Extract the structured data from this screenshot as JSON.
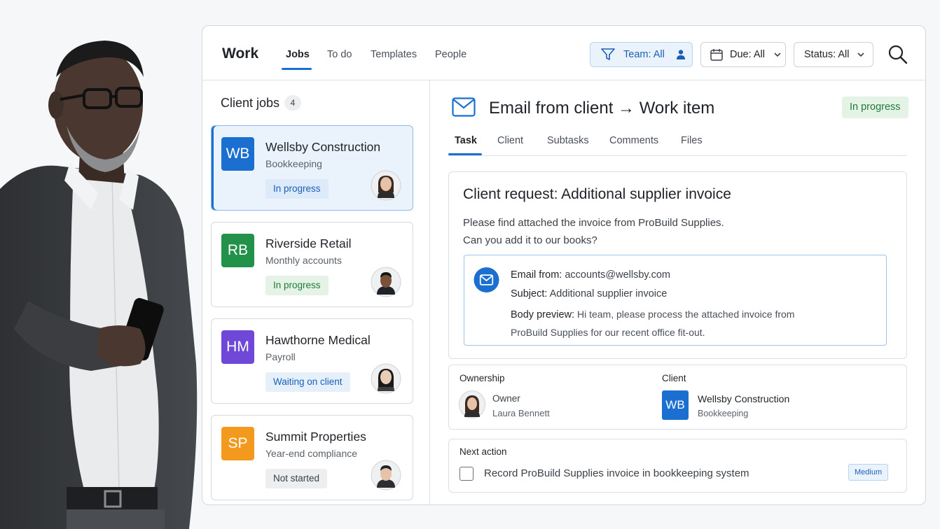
{
  "header": {
    "brand": "Work",
    "nav_tabs": [
      {
        "label": "Jobs",
        "active": true
      },
      {
        "label": "To do"
      },
      {
        "label": "Templates"
      },
      {
        "label": "People"
      }
    ],
    "filters": {
      "team": {
        "label": "Team: All",
        "icon": "filter-icon",
        "trailing_icon": "person-icon"
      },
      "due": {
        "label": "Due: All",
        "icon": "calendar-icon",
        "trailing_icon": "chevron-down-icon"
      },
      "status": {
        "label": "Status: All",
        "trailing_icon": "chevron-down-icon"
      }
    },
    "search_icon": "search-icon"
  },
  "client_jobs": {
    "title": "Client jobs",
    "count": "4",
    "jobs": [
      {
        "initials": "WB",
        "name": "Wellsby Construction",
        "type": "Bookkeeping",
        "status": "In progress",
        "avatar_color": "#1a6fd0",
        "status_bg": "#dceafa",
        "status_color": "#1a5fb4",
        "selected": true
      },
      {
        "initials": "RB",
        "name": "Riverside Retail",
        "type": "Monthly accounts",
        "status": "In progress",
        "avatar_color": "#22914a",
        "status_bg": "#e4f3e6",
        "status_color": "#217a39"
      },
      {
        "initials": "HM",
        "name": "Hawthorne Medical",
        "type": "Payroll",
        "status": "Waiting on client",
        "avatar_color": "#6f48d8",
        "status_bg": "#e6f0fb",
        "status_color": "#1a5fb4"
      },
      {
        "initials": "SP",
        "name": "Summit Properties",
        "type": "Year-end compliance",
        "status": "Not started",
        "avatar_color": "#f39a1e",
        "status_bg": "#eceef0",
        "status_color": "#3b4148"
      }
    ]
  },
  "detail": {
    "title": "Email from client → Work item",
    "status": "In progress",
    "tabs": [
      {
        "label": "Task",
        "active": true
      },
      {
        "label": "Client"
      },
      {
        "label": "Subtasks"
      },
      {
        "label": "Comments"
      },
      {
        "label": "Files"
      }
    ],
    "request": {
      "title": "Client request: Additional supplier invoice",
      "body_line1": "Please find attached the invoice from ProBuild Supplies.",
      "body_line2": "Can you add it to our books?",
      "email": {
        "from_label": "Email from:",
        "from_value": "accounts@wellsby.com",
        "subject_label": "Subject:",
        "subject_value": "Additional supplier invoice",
        "preview_label": "Body preview:",
        "preview_value": "Hi team, please process the attached invoice from ProBuild Supplies for our recent office fit-out."
      }
    },
    "ownership": {
      "label": "Ownership",
      "role": "Owner",
      "name": "Laura Bennett"
    },
    "client": {
      "label": "Client",
      "initials": "WB",
      "name": "Wellsby Construction",
      "type": "Bookkeeping"
    },
    "next_action": {
      "label": "Next action",
      "text": "Record ProBuild Supplies invoice in bookkeeping system",
      "priority": "Medium"
    }
  },
  "colors": {
    "accent": "#1a6fd0",
    "success": "#217a39"
  }
}
